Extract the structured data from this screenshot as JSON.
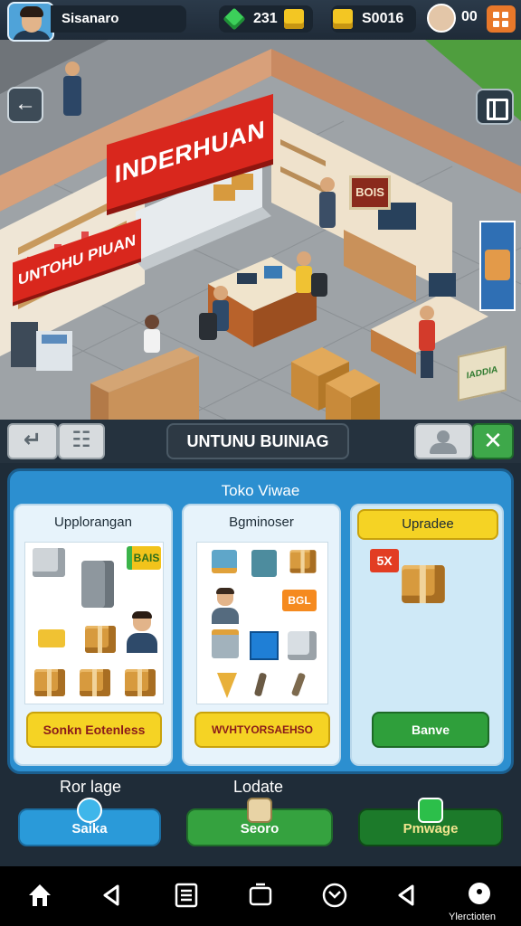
{
  "hud": {
    "player_name": "Sisanaro",
    "gems": "231",
    "gold": "S0016",
    "friends": "00"
  },
  "scene": {
    "sign_main": "INDERHUAN",
    "sign_small": "UNTOHU PIUAN",
    "sign_board": "BOIS",
    "crate_label": "IADDIA"
  },
  "panel": {
    "title": "UNTUNU BUINIAG",
    "shop_name": "Toko Viwae",
    "cards": [
      {
        "title": "Upplorangan",
        "tag": "BAIS",
        "button": "Sonkn Eotenless"
      },
      {
        "title": "Bgminoser",
        "tag": "BGL",
        "button": "WVHTYORSAEHSO"
      },
      {
        "title": "Upradee",
        "tag": "5X",
        "button": "Banve"
      }
    ],
    "sub_labels": {
      "left": "Ror lage",
      "mid": "Lodate"
    },
    "bottom_buttons": [
      "Saika",
      "Seoro",
      "Pmwage"
    ]
  },
  "sysnav": {
    "label": "Ylerctioten",
    "icons": [
      "home-icon",
      "back-icon",
      "list-icon",
      "window-icon",
      "compass-icon",
      "back-triangle-icon",
      "assistant-icon"
    ]
  },
  "colors": {
    "accent_blue": "#2c8fd0",
    "accent_green": "#35a23f",
    "accent_yellow": "#f5d324",
    "sign_red": "#d9271d"
  }
}
